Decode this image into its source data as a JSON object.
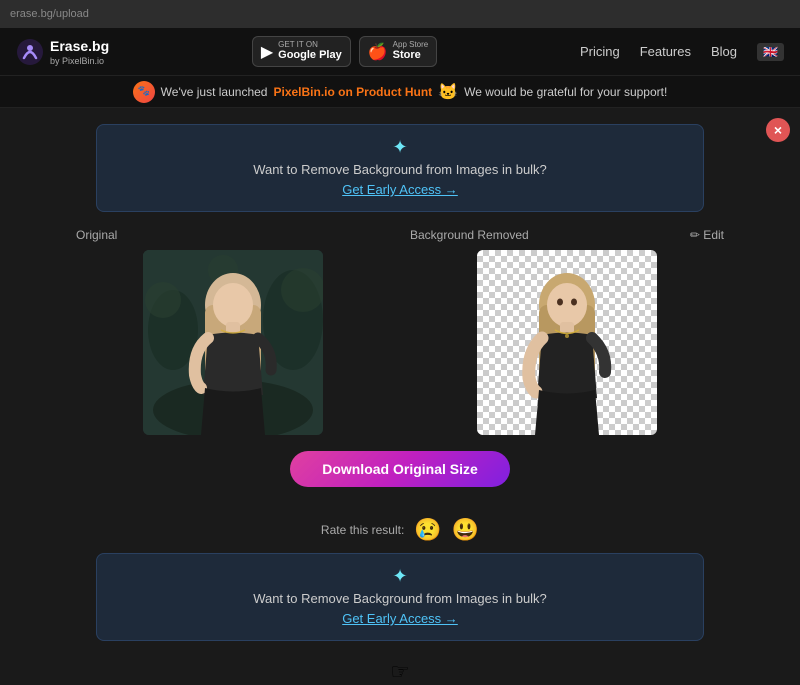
{
  "browser": {
    "url": "erase.bg/upload"
  },
  "header": {
    "logo_text": "Erase.bg",
    "logo_sub": "by PixelBin.io",
    "google_play_small": "GET IT ON",
    "google_play_big": "Google Play",
    "app_store_small": "App Store",
    "app_store_big": "Store",
    "nav": [
      "Pricing",
      "Features",
      "Blog"
    ],
    "flag": "🇬🇧"
  },
  "ph_banner": {
    "text_before": "We've just launched",
    "link_text": "PixelBin.io on Product Hunt",
    "cat": "🐱",
    "text_after": "We would be grateful for your support!"
  },
  "early_banner_top": {
    "sparkle": "✦",
    "text": "Want to Remove Background from Images in bulk?",
    "link": "Get Early Access →"
  },
  "comparison": {
    "original_label": "Original",
    "removed_label": "Background Removed",
    "edit_label": "✏ Edit"
  },
  "download": {
    "button_label": "Download Original Size"
  },
  "rating": {
    "label": "Rate this result:",
    "sad_emoji": "😢",
    "happy_emoji": "😃"
  },
  "early_banner_bottom": {
    "sparkle": "✦",
    "text": "Want to Remove Background from Images in bulk?",
    "link": "Get Early Access →"
  },
  "close_btn": "×"
}
